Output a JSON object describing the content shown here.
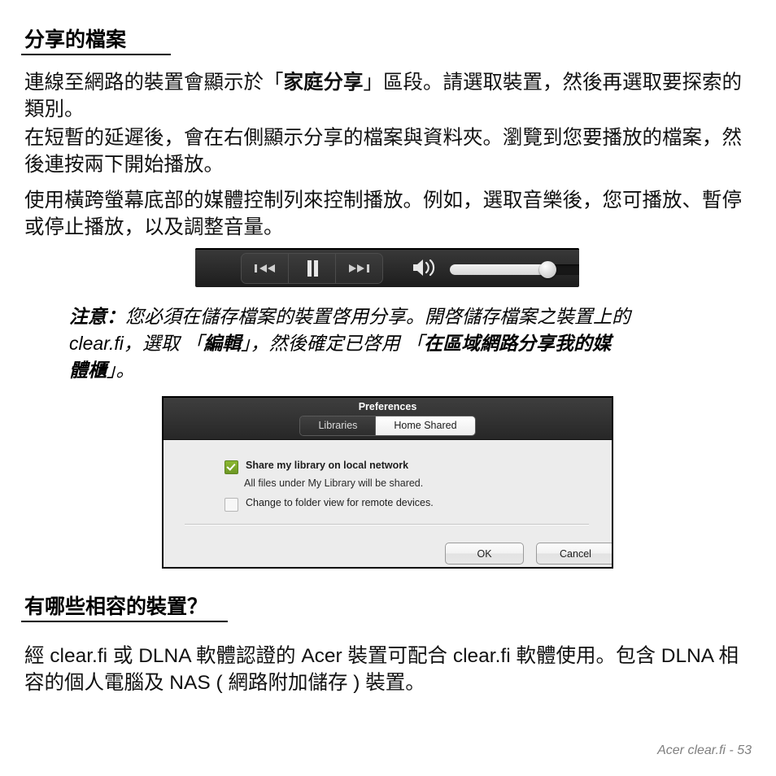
{
  "document": {
    "heading_1": "分享的檔案",
    "paragraphs": [
      {
        "id": "p1",
        "runs": [
          {
            "text": "連線至網路的裝置會顯示於「",
            "bold": false
          },
          {
            "text": "家庭分享",
            "bold": true
          },
          {
            "text": "」區段。請選取裝置，然後再選取要探索的類別。",
            "bold": false
          }
        ],
        "plain": "連線至網路的裝置會顯示於「家庭分享」區段。請選取裝置，然後再選取要探索的類別。"
      },
      {
        "id": "p2",
        "plain": "在短暫的延遲後，會在右側顯示分享的檔案與資料夾。瀏覽到您要播放的檔案，然後連按兩下開始播放。"
      },
      {
        "id": "p3",
        "plain": "使用橫跨螢幕底部的媒體控制列來控制播放。例如，選取音樂後，您可播放、暫停或停止播放，以及調整音量。"
      }
    ],
    "note": {
      "label": "注意：",
      "line1": "您必須在儲存檔案的裝置啓用分享。開啓儲存檔案之裝置上的",
      "line2_a": "clear.fi，選取 「",
      "line2_b": "編輯",
      "line2_c": "」，然後確定已啓用 「",
      "line2_d": "在區域網路分享我的媒",
      "line3_a": "體櫃",
      "line3_b": "」。"
    },
    "heading_2": "有哪些相容的裝置？",
    "paragraph_4": "經 clear.fi 或 DLNA 軟體認證的 Acer 裝置可配合 clear.fi 軟體使用。包含 DLNA 相容的個人電腦及 NAS ( 網路附加儲存 ) 裝置。",
    "footer": "Acer clear.fi -  53"
  },
  "media_bar": {
    "buttons": [
      {
        "name": "previous-track-button",
        "icon": "previous-icon"
      },
      {
        "name": "pause-button",
        "icon": "pause-icon"
      },
      {
        "name": "next-track-button",
        "icon": "next-icon"
      }
    ],
    "volume": {
      "icon": "volume-icon",
      "level_percent": 70
    }
  },
  "preferences_dialog": {
    "title": "Preferences",
    "tabs": [
      {
        "label": "Libraries",
        "active": false
      },
      {
        "label": "Home Shared",
        "active": true
      }
    ],
    "options": [
      {
        "label": "Share my library on local network",
        "checked": true,
        "description": "All files under My Library will be shared."
      },
      {
        "label": "Change to folder view for remote devices.",
        "checked": false
      }
    ],
    "buttons": [
      {
        "label": "OK",
        "name": "ok-button"
      },
      {
        "label": "Cancel",
        "name": "cancel-button"
      }
    ]
  },
  "colors": {
    "page_background": "#ffffff",
    "text": "#111111",
    "footer_text": "#808080",
    "dialog_body": "#ececec",
    "dialog_header": "#333333",
    "checkbox_green": "#7da62b",
    "media_bar": "#2b2b2b"
  }
}
